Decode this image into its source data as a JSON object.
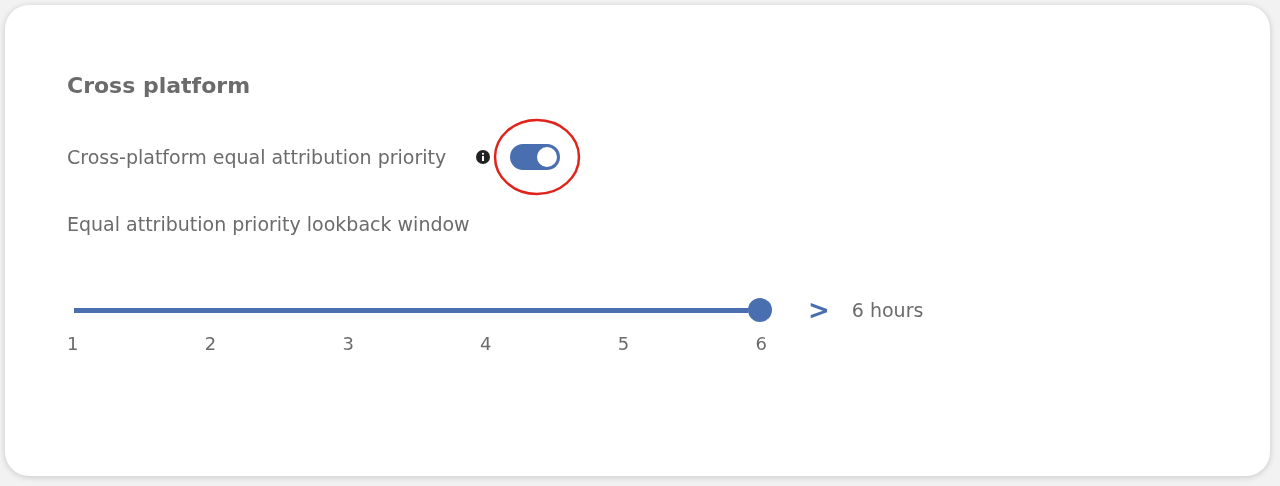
{
  "section": {
    "title": "Cross platform"
  },
  "toggle_setting": {
    "label": "Cross-platform equal attribution priority",
    "on": true,
    "highlighted": true
  },
  "lookback": {
    "label": "Equal attribution priority lookback window",
    "level": 1,
    "marker": ">",
    "reading": "6 hours",
    "ticks": [
      "1",
      "2",
      "3",
      "4",
      "5",
      "6"
    ]
  }
}
